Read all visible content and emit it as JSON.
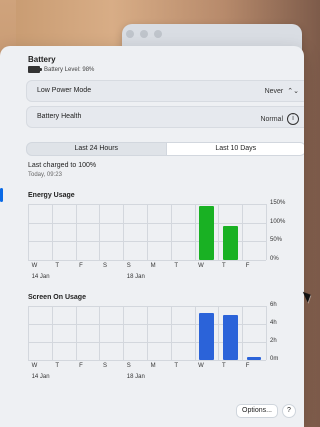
{
  "window": {
    "header": {
      "title": "Battery",
      "battery_level_text": "Battery Level: 98%"
    },
    "settings": {
      "low_power_mode": {
        "label": "Low Power Mode",
        "value": "Never"
      },
      "battery_health": {
        "label": "Battery Health",
        "value": "Normal"
      }
    },
    "range_tabs": {
      "options": [
        "Last 24 Hours",
        "Last 10 Days"
      ],
      "selected": "Last 10 Days"
    },
    "last_charged": {
      "label": "Last charged to 100%",
      "time": "Today, 09:23"
    },
    "energy": {
      "title": "Energy Usage",
      "y_ticks": [
        "150%",
        "100%",
        "50%",
        "0%"
      ]
    },
    "screen": {
      "title": "Screen On Usage",
      "y_ticks": [
        "6h",
        "4h",
        "2h",
        "0m"
      ]
    },
    "x_axis": {
      "day_labels": [
        "W",
        "T",
        "F",
        "S",
        "S",
        "M",
        "T",
        "W",
        "T",
        "F"
      ],
      "date_labels": [
        {
          "text": "14 Jan",
          "index": 0
        },
        {
          "text": "18 Jan",
          "index": 4
        }
      ]
    },
    "footer": {
      "options_label": "Options...",
      "help_label": "?"
    },
    "colors": {
      "energy_bar": "#19b123",
      "screen_bar": "#2b63d9",
      "accent": "#0a6ae6"
    }
  },
  "chart_data": [
    {
      "type": "bar",
      "title": "Energy Usage",
      "categories": [
        "W",
        "T",
        "F",
        "S",
        "S",
        "M",
        "T",
        "W",
        "T",
        "F"
      ],
      "values": [
        0,
        0,
        0,
        0,
        0,
        0,
        0,
        145,
        92,
        0
      ],
      "ylim": [
        0,
        150
      ],
      "ylabel": "",
      "y_ticks": [
        "0%",
        "50%",
        "100%",
        "150%"
      ]
    },
    {
      "type": "bar",
      "title": "Screen On Usage",
      "categories": [
        "W",
        "T",
        "F",
        "S",
        "S",
        "M",
        "T",
        "W",
        "T",
        "F"
      ],
      "values": [
        0,
        0,
        0,
        0,
        0,
        0,
        0,
        5.2,
        5.0,
        0.3
      ],
      "ylim": [
        0,
        6
      ],
      "ylabel": "",
      "y_ticks": [
        "0m",
        "2h",
        "4h",
        "6h"
      ]
    }
  ]
}
